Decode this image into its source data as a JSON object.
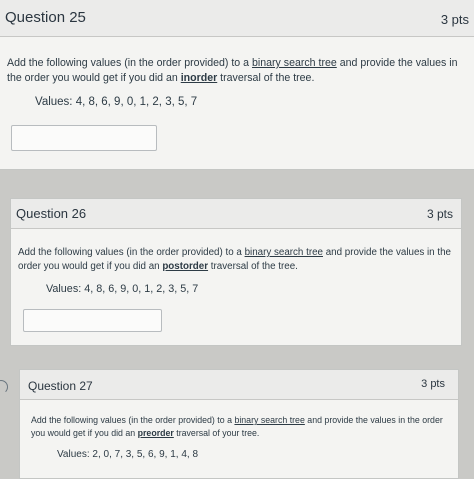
{
  "questions": [
    {
      "title": "Question 25",
      "points": "3 pts",
      "prompt_before": "Add the following values (in the order provided) to a ",
      "prompt_link": "binary search tree",
      "prompt_middle": " and provide the values in the order you would get if you did an ",
      "traversal": "inorder",
      "prompt_after": " traversal of the tree.",
      "values": "Values: 4, 8, 6, 9, 0, 1, 2, 3, 5, 7",
      "answer": ""
    },
    {
      "title": "Question 26",
      "points": "3 pts",
      "prompt_before": "Add the following values (in the order provided) to a ",
      "prompt_link": "binary search tree",
      "prompt_middle": " and provide the values in the order you would get if you did an ",
      "traversal": "postorder",
      "prompt_after": " traversal of the tree.",
      "values": "Values: 4, 8, 6, 9, 0, 1, 2, 3, 5, 7",
      "answer": ""
    },
    {
      "title": "Question 27",
      "points": "3 pts",
      "prompt_before": "Add the following values (in the order provided) to a ",
      "prompt_link": "binary search tree",
      "prompt_middle": " and provide the values in the order you would get if you did an ",
      "traversal": "preorder",
      "prompt_after": " traversal of your tree.",
      "values": "Values: 2, 0, 7, 3, 5, 6, 9, 1, 4, 8",
      "answer": ""
    }
  ]
}
